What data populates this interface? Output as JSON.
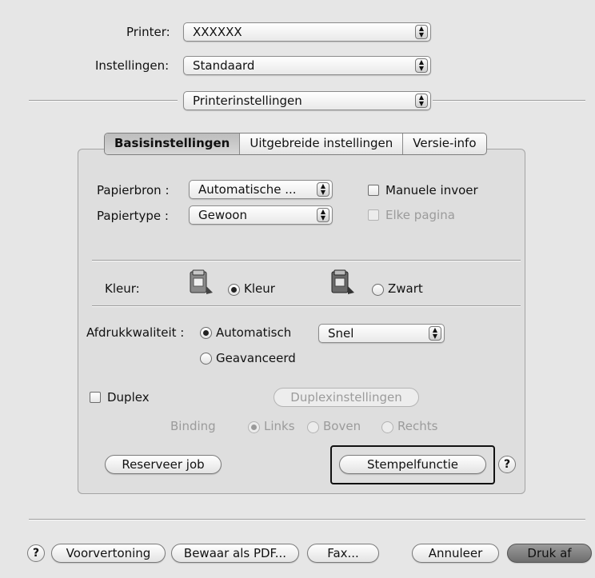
{
  "header": {
    "printer_label": "Printer:",
    "printer_value": "XXXXXX",
    "settings_label": "Instellingen:",
    "settings_value": "Standaard",
    "pane_value": "Printerinstellingen"
  },
  "tabs": [
    {
      "label": "Basisinstellingen"
    },
    {
      "label": "Uitgebreide instellingen"
    },
    {
      "label": "Versie-info"
    }
  ],
  "paper": {
    "source_label": "Papierbron :",
    "source_value": "Automatische ...",
    "type_label": "Papiertype :",
    "type_value": "Gewoon",
    "manual_feed_label": "Manuele invoer",
    "each_page_label": "Elke pagina"
  },
  "color": {
    "label": "Kleur:",
    "option_color": "Kleur",
    "option_black": "Zwart"
  },
  "quality": {
    "label": "Afdrukkwaliteit :",
    "option_auto": "Automatisch",
    "option_advanced": "Geavanceerd",
    "speed_value": "Snel"
  },
  "duplex": {
    "label": "Duplex",
    "settings_button": "Duplexinstellingen",
    "binding_label": "Binding",
    "binding_left": "Links",
    "binding_top": "Boven",
    "binding_right": "Rechts"
  },
  "panel_buttons": {
    "reserve_job": "Reserveer job",
    "stamp_function": "Stempelfunctie",
    "help": "?"
  },
  "footer": {
    "help": "?",
    "preview": "Voorvertoning",
    "save_pdf": "Bewaar als PDF...",
    "fax": "Fax...",
    "cancel": "Annuleer",
    "print": "Druk af"
  }
}
